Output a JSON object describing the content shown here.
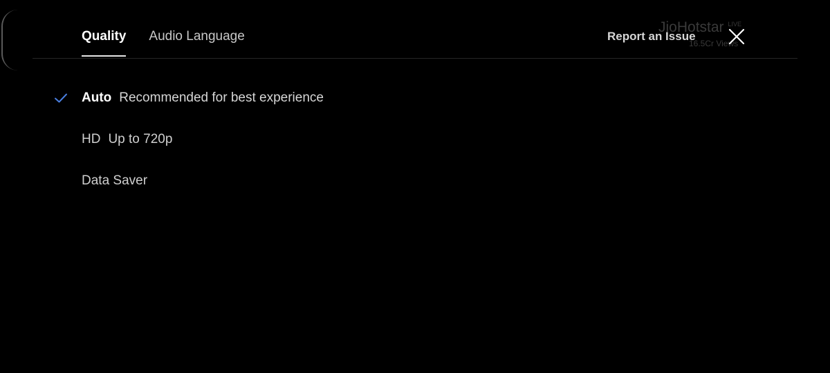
{
  "background": {
    "brand": "JioHotstar",
    "live_badge": "LIVE",
    "views": "16.5Cr Views"
  },
  "header": {
    "tabs": [
      {
        "label": "Quality",
        "active": true
      },
      {
        "label": "Audio Language",
        "active": false
      }
    ],
    "report_label": "Report an Issue",
    "close_icon": "close-icon"
  },
  "options": [
    {
      "name": "Auto",
      "desc": "Recommended for best experience",
      "selected": true
    },
    {
      "name": "HD",
      "desc": "Up to 720p",
      "selected": false
    },
    {
      "name": "Data Saver",
      "desc": "",
      "selected": false
    }
  ],
  "colors": {
    "background": "#000000",
    "check": "#4a7fe0",
    "active_tab_underline": "#e8e8e8"
  }
}
